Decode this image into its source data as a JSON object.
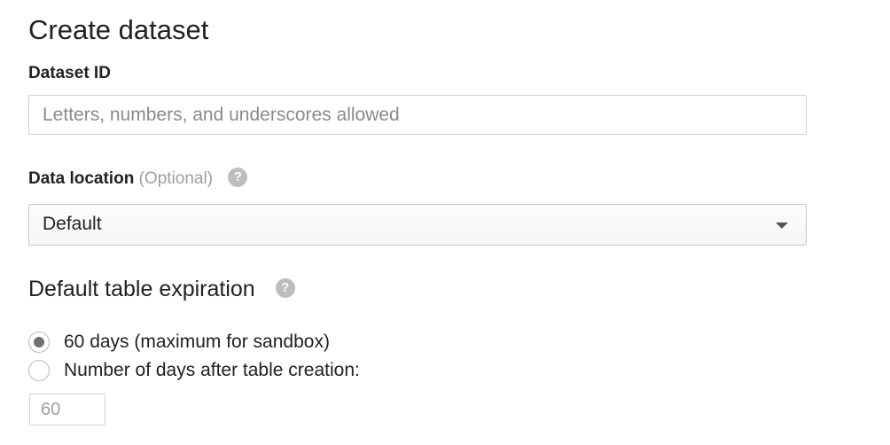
{
  "dialog": {
    "title": "Create dataset"
  },
  "dataset_id": {
    "label": "Dataset ID",
    "value": "",
    "placeholder": "Letters, numbers, and underscores allowed"
  },
  "data_location": {
    "label": "Data location",
    "optional_text": "(Optional)",
    "help_icon": "?",
    "selected": "Default"
  },
  "expiration": {
    "heading": "Default table expiration",
    "help_icon": "?",
    "options": [
      {
        "label": "60 days (maximum for sandbox)",
        "checked": true
      },
      {
        "label": "Number of days after table creation:",
        "checked": false
      }
    ],
    "days_value": "60"
  },
  "icons": {
    "help": "help-icon",
    "dropdown": "caret-down-icon"
  }
}
